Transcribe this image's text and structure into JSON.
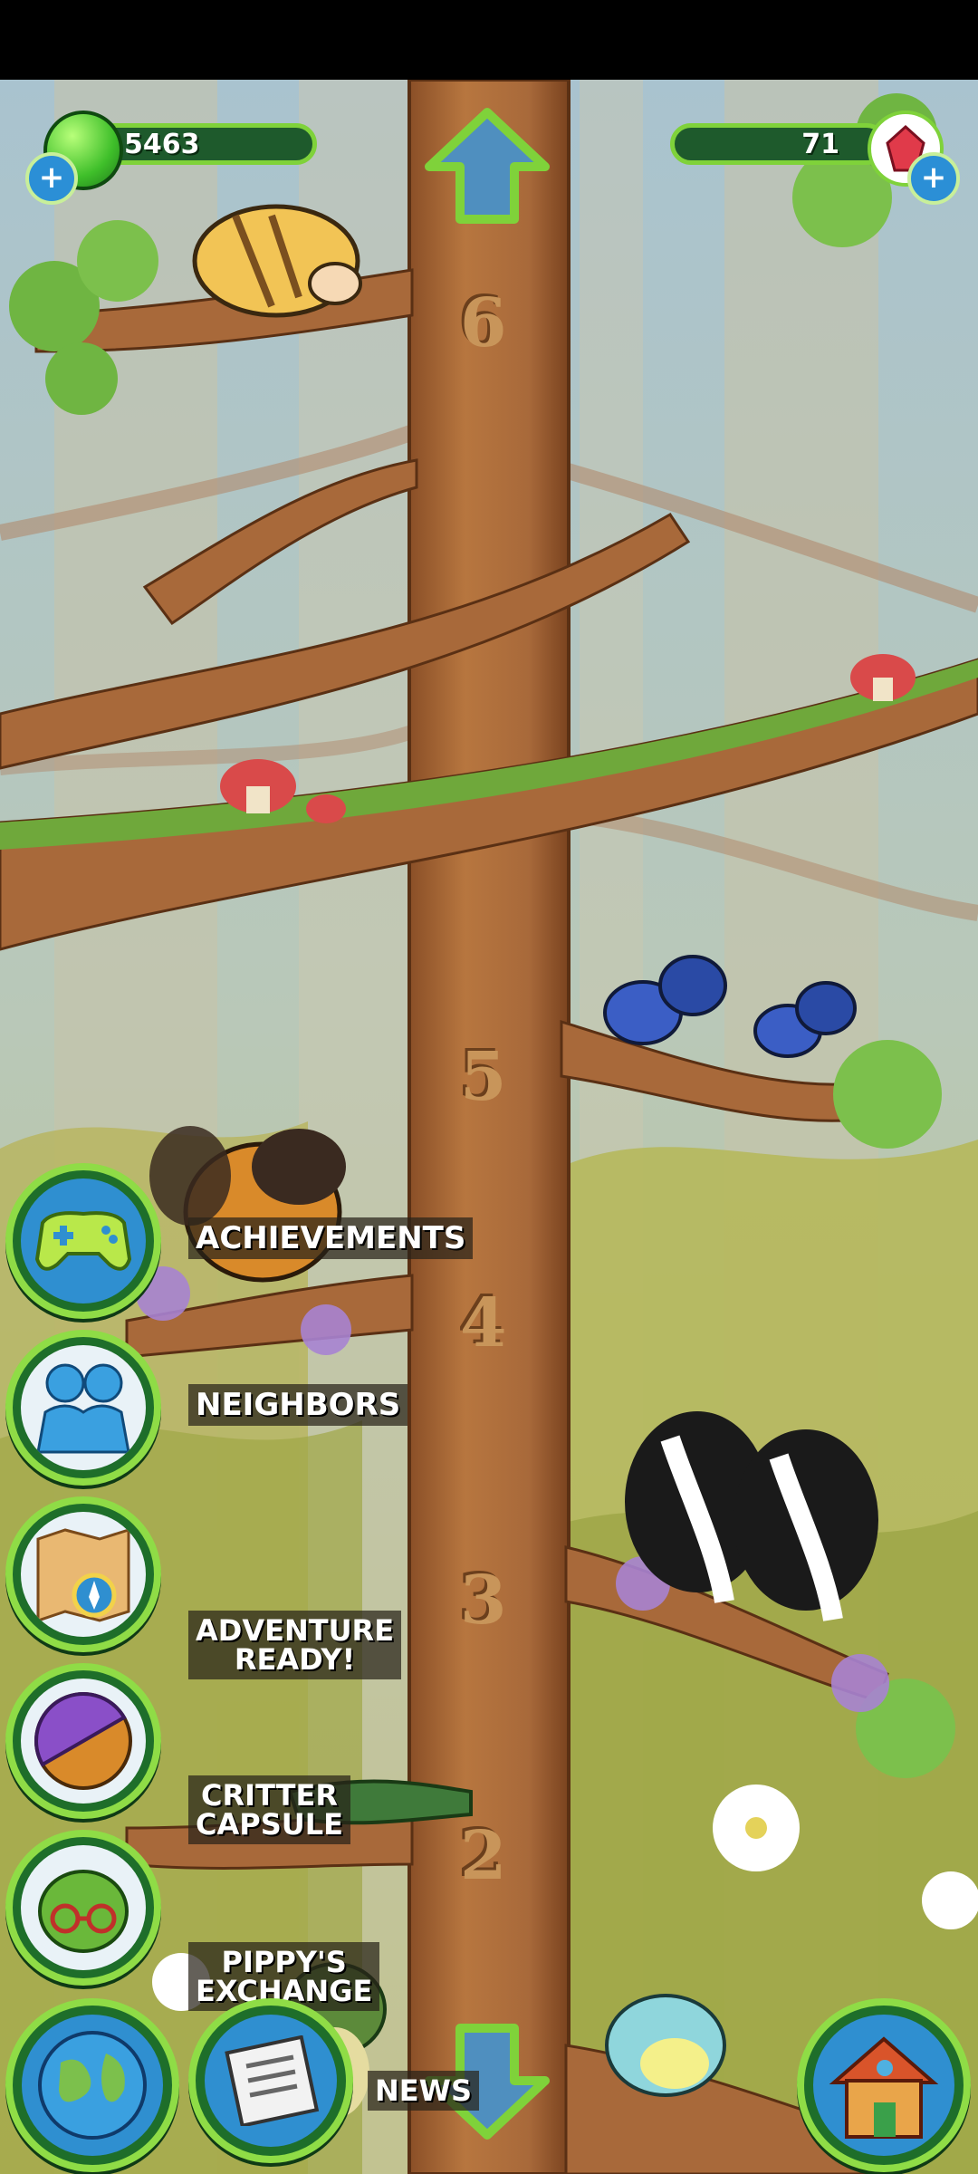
{
  "hud": {
    "gems": "5463",
    "crystals": "71"
  },
  "floors": [
    "6",
    "5",
    "4",
    "3",
    "2"
  ],
  "menu": {
    "achievements": "ACHIEVEMENTS",
    "neighbors": "NEIGHBORS",
    "adventure_line1": "ADVENTURE",
    "adventure_line2": "READY!",
    "critter_line1": "CRITTER",
    "critter_line2": "CAPSULE",
    "pippy_line1": "PIPPY'S",
    "pippy_line2": "EXCHANGE",
    "news": "NEWS"
  },
  "icons": {
    "gem": "green-gem-icon",
    "crystal": "red-crystal-icon",
    "plus": "plus-icon",
    "up": "up-arrow-icon",
    "down": "down-arrow-icon",
    "achievements": "gamepad-icon",
    "neighbors": "people-icon",
    "adventure": "map-compass-icon",
    "critter": "capsule-icon",
    "pippy": "pippy-face-icon",
    "globe": "globe-icon",
    "news": "newspaper-icon",
    "home": "house-icon"
  },
  "colors": {
    "hud_green": "#1e5a2c",
    "hud_border": "#7fd23a",
    "trunk": "#a8693a",
    "forest_bg": "#b7c6c1"
  }
}
